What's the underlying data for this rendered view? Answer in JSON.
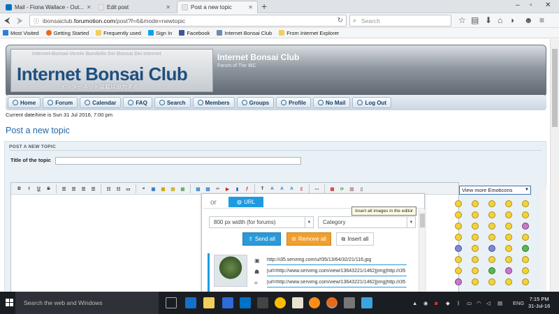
{
  "browser": {
    "tabs": [
      {
        "label": "Mail - Fiona Wallace - Out...",
        "active": false,
        "color": "#0072c6"
      },
      {
        "label": "Edit post",
        "active": false,
        "color": "#e5e5e5"
      },
      {
        "label": "Post a new topic",
        "active": true,
        "color": "#e5e5e5"
      }
    ],
    "new_tab_label": "+",
    "window_controls": [
      "–",
      "▫",
      "✕"
    ],
    "url_prefix": "ibonsaiclub.",
    "url_domain": "forumotion.com",
    "url_rest": "/post?f=6&mode=newtopic",
    "search_placeholder": "Search",
    "bookmarks": [
      {
        "label": "Most Visited",
        "color": "#2d7fd3"
      },
      {
        "label": "Getting Started",
        "color": "#e66a1e"
      },
      {
        "label": "Frequently used",
        "color": "#f2cf5b"
      },
      {
        "label": "Sign In",
        "color": "#00a4ef"
      },
      {
        "label": "Facebook",
        "color": "#3b5998"
      },
      {
        "label": "Internet Bonsai Club",
        "color": "#6a8caf"
      },
      {
        "label": "From Internet Explorer",
        "color": "#f2cf5b"
      }
    ]
  },
  "site": {
    "logo_ghost_text": "Internet-Bonsai-Verein  Bandello Dei Bonsai Dei Internet",
    "logo_main": "Internet Bonsai Club",
    "logo_jp": "インターネット盆栽は協力する",
    "title": "Internet Bonsai Club",
    "subtitle": "Forum of The IBC",
    "menu": [
      "Home",
      "Forum",
      "Calendar",
      "FAQ",
      "Search",
      "Members",
      "Groups",
      "Profile",
      "No Mail",
      "Log Out"
    ],
    "datetime": "Current date/time is Sun 31 Jul 2016, 7:00 pm",
    "page_title": "Post a new topic"
  },
  "form": {
    "heading": "POST A NEW TOPIC",
    "title_label": "Title of the topic",
    "title_value": ""
  },
  "toolbar": {
    "buttons": [
      "B",
      "I",
      "U",
      "S"
    ]
  },
  "upload_popup": {
    "or_label": "or",
    "url_tab_label": "URL",
    "size_select": "800 px width (for forums)",
    "category_select": "Category",
    "send_all": "Send all",
    "remove_all": "Remove all",
    "insert_all": "Insert all",
    "image_links": [
      "http://i35.servimg.com/u/f35/13/64/32/21/116.jpg",
      "[url=http://www.servimg.com/view/13643221/1462][img]http://i35",
      "[url=http://www.servimg.com/view/13643221/1462][img]http://i35"
    ],
    "tooltip": "Insert all images in the editor"
  },
  "emoticons": {
    "select_label": "View more Emoticons"
  },
  "taskbar": {
    "search_placeholder": "Search the web and Windows",
    "time": "7:15 PM",
    "date": "31-Jul-16",
    "lang": "ENG"
  }
}
